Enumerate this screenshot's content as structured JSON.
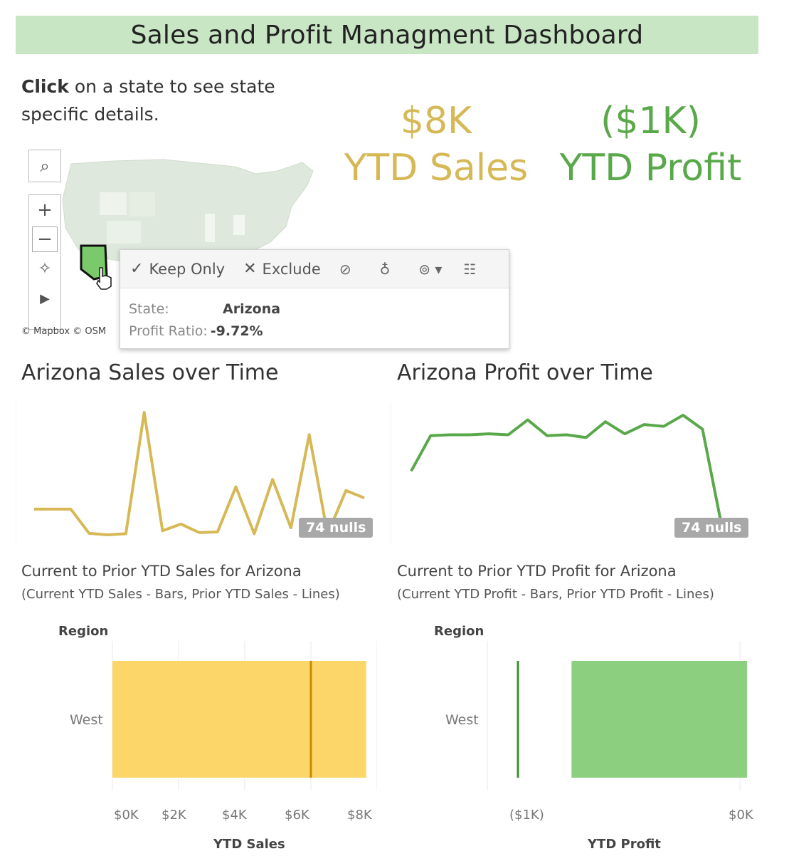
{
  "title": "Sales and Profit Managment Dashboard",
  "instructions": {
    "bold": "Click",
    "rest": " on a state to see state specific details."
  },
  "kpis": {
    "sales_value": "$8K",
    "sales_label": "YTD Sales",
    "profit_value": "($1K)",
    "profit_label": "YTD Profit",
    "sales_color": "#d6b856",
    "profit_color": "#59a84a"
  },
  "map": {
    "attribution": "© Mapbox © OSM",
    "controls": [
      "search-icon",
      "zoom-in-icon",
      "zoom-out-icon",
      "pin-icon",
      "expand-icon"
    ],
    "selected_state_color": "#7ac96b"
  },
  "tooltip": {
    "keep_only": "Keep Only",
    "exclude": "Exclude",
    "state_key": "State:",
    "state_value": "Arizona",
    "ratio_key": "Profit Ratio:",
    "ratio_value": "-9.72%"
  },
  "sales_over_time": {
    "title": "Arizona Sales over Time",
    "nulls": "74 nulls",
    "color": "#d6b856"
  },
  "profit_over_time": {
    "title": "Arizona Profit over Time",
    "nulls": "74 nulls",
    "color": "#59a84a"
  },
  "sales_compare": {
    "title": "Current to Prior YTD Sales for Arizona",
    "note": "(Current YTD Sales - Bars, Prior YTD Sales - Lines)",
    "row_header": "Region",
    "xlabel": "YTD Sales"
  },
  "profit_compare": {
    "title": "Current to Prior YTD Profit for Arizona",
    "note": "(Current YTD Profit - Bars, Prior YTD Profit - Lines)",
    "row_header": "Region",
    "xlabel": "YTD Profit"
  },
  "chart_data": [
    {
      "type": "line",
      "title": "Arizona Sales over Time",
      "y": [
        700,
        700,
        700,
        50,
        10,
        40,
        3300,
        120,
        300,
        70,
        90,
        1300,
        40,
        1500,
        200,
        2700,
        30,
        1200,
        1000
      ],
      "color": "#d6b856"
    },
    {
      "type": "line",
      "title": "Arizona Profit over Time",
      "y": [
        -300,
        80,
        90,
        90,
        100,
        90,
        250,
        80,
        90,
        60,
        230,
        100,
        200,
        180,
        300,
        150,
        -900,
        -1000
      ],
      "color": "#59a84a"
    },
    {
      "type": "bar",
      "title": "Current to Prior YTD Sales for Arizona",
      "categories": [
        "West"
      ],
      "series": [
        {
          "name": "Current YTD Sales",
          "values": [
            8250
          ]
        },
        {
          "name": "Prior YTD Sales",
          "values": [
            6450
          ]
        }
      ],
      "xlabel": "YTD Sales",
      "ylabel": "Region",
      "ticks": [
        "$0K",
        "$2K",
        "$4K",
        "$6K",
        "$8K"
      ],
      "xlim": [
        0,
        8600
      ],
      "bar_color": "#fdd66a",
      "line_color": "#c88a00"
    },
    {
      "type": "bar",
      "title": "Current to Prior YTD Profit for Arizona",
      "categories": [
        "West"
      ],
      "series": [
        {
          "name": "Current YTD Profit",
          "values": [
            -1100
          ]
        },
        {
          "name": "Prior YTD Profit",
          "values": [
            -1450
          ]
        }
      ],
      "xlabel": "YTD Profit",
      "ylabel": "Region",
      "ticks": [
        "($1K)",
        "$0K"
      ],
      "xlim": [
        -1650,
        0
      ],
      "bar_color": "#8ccf7e",
      "line_color": "#3b8f2e"
    }
  ]
}
